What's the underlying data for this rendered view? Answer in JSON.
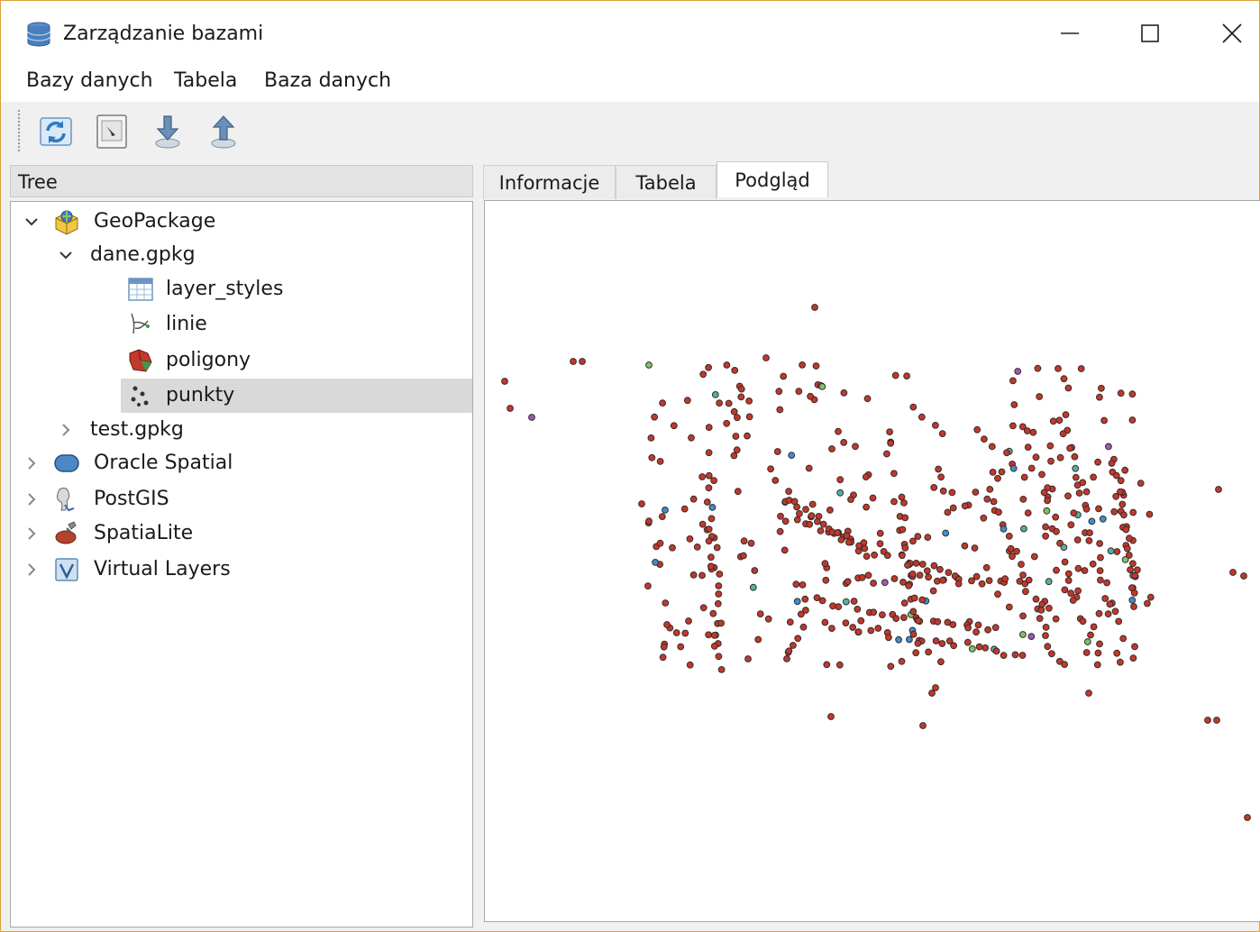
{
  "window": {
    "title": "Zarządzanie bazami",
    "controls": [
      "minimize",
      "maximize",
      "close"
    ]
  },
  "menubar": {
    "items": [
      "Bazy danych",
      "Tabela",
      "Baza danych"
    ]
  },
  "toolbar": {
    "buttons": [
      {
        "icon": "refresh-icon"
      },
      {
        "icon": "sql-window-icon"
      },
      {
        "icon": "import-layer-icon"
      },
      {
        "icon": "export-layer-icon"
      }
    ]
  },
  "tree": {
    "header": "Tree",
    "nodes": [
      {
        "label": "GeoPackage",
        "icon": "geopackage-icon",
        "expanded": true
      },
      {
        "label": "dane.gpkg",
        "expanded": true
      },
      {
        "label": "layer_styles",
        "icon": "table-icon"
      },
      {
        "label": "linie",
        "icon": "line-layer-icon"
      },
      {
        "label": "poligony",
        "icon": "polygon-layer-icon"
      },
      {
        "label": "punkty",
        "icon": "point-layer-icon",
        "selected": true
      },
      {
        "label": "test.gpkg",
        "expanded": false
      },
      {
        "label": "Oracle Spatial",
        "icon": "oracle-icon",
        "expanded": false
      },
      {
        "label": "PostGIS",
        "icon": "postgis-icon",
        "expanded": false
      },
      {
        "label": "SpatiaLite",
        "icon": "spatialite-icon",
        "expanded": false
      },
      {
        "label": "Virtual Layers",
        "icon": "virtual-layers-icon",
        "expanded": false
      }
    ]
  },
  "tabs": {
    "items": [
      "Informacje",
      "Tabela",
      "Podgląd"
    ],
    "active": "Podgląd"
  },
  "preview": {
    "layer": "punkty",
    "point_colors": {
      "main": "#c0392b",
      "stroke": "#3a2a2a",
      "accents": [
        "#4fb3a3",
        "#9b59b6",
        "#7cc36b",
        "#3b8fd0"
      ]
    }
  }
}
